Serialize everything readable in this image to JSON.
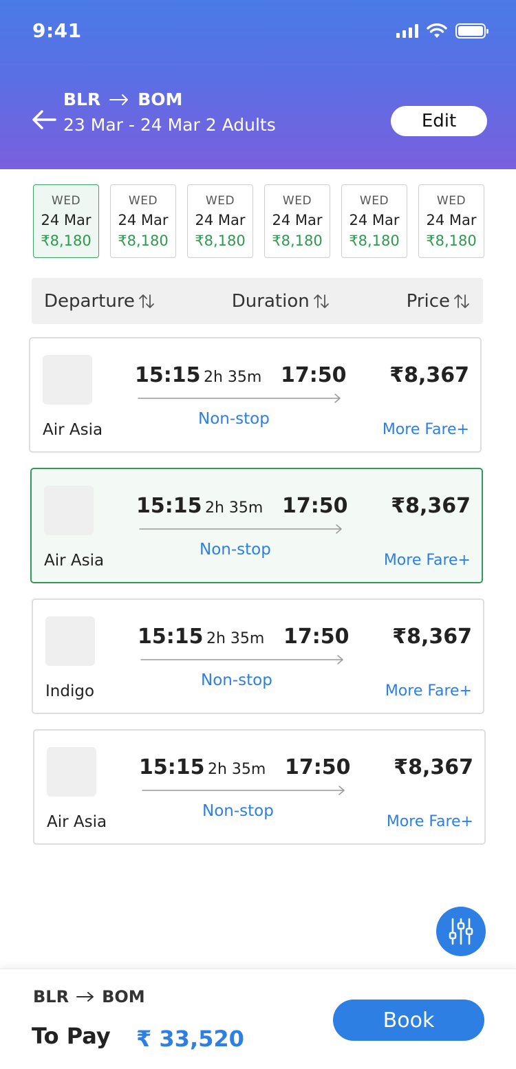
{
  "status_bar": {
    "time": "9:41"
  },
  "header": {
    "origin": "BLR",
    "destination": "BOM",
    "trip_info": "23 Mar - 24 Mar 2 Adults",
    "edit_label": "Edit"
  },
  "dates": [
    {
      "day": "WED",
      "date": "24 Mar",
      "price": "₹8,180",
      "selected": true
    },
    {
      "day": "WED",
      "date": "24 Mar",
      "price": "₹8,180",
      "selected": false
    },
    {
      "day": "WED",
      "date": "24 Mar",
      "price": "₹8,180",
      "selected": false
    },
    {
      "day": "WED",
      "date": "24 Mar",
      "price": "₹8,180",
      "selected": false
    },
    {
      "day": "WED",
      "date": "24 Mar",
      "price": "₹8,180",
      "selected": false
    },
    {
      "day": "WED",
      "date": "24 Mar",
      "price": "₹8,180",
      "selected": false
    }
  ],
  "sort": {
    "departure": "Departure",
    "duration": "Duration",
    "price": "Price"
  },
  "flights": [
    {
      "airline": "Air Asia",
      "departure": "15:15",
      "duration": "2h 35m",
      "arrival": "17:50",
      "stops": "Non-stop",
      "price": "₹8,367",
      "more_fare": "More Fare+",
      "selected": false
    },
    {
      "airline": "Air Asia",
      "departure": "15:15",
      "duration": "2h 35m",
      "arrival": "17:50",
      "stops": "Non-stop",
      "price": "₹8,367",
      "more_fare": "More Fare+",
      "selected": true
    },
    {
      "airline": "Indigo",
      "departure": "15:15",
      "duration": "2h 35m",
      "arrival": "17:50",
      "stops": "Non-stop",
      "price": "₹8,367",
      "more_fare": "More Fare+",
      "selected": false
    },
    {
      "airline": "Air Asia",
      "departure": "15:15",
      "duration": "2h 35m",
      "arrival": "17:50",
      "stops": "Non-stop",
      "price": "₹8,367",
      "more_fare": "More Fare+",
      "selected": false
    }
  ],
  "bottom": {
    "origin": "BLR",
    "destination": "BOM",
    "to_pay_label": "To Pay",
    "to_pay_amount": "₹ 33,520",
    "book_label": "Book"
  },
  "icons": {
    "back": "arrow-left-icon",
    "route": "arrow-right-icon",
    "sort": "sort-up-down-icon",
    "filter": "sliders-icon",
    "signal": "signal-icon",
    "wifi": "wifi-icon",
    "battery": "battery-icon"
  },
  "colors": {
    "accent": "#2d7fe3",
    "header_gradient_top": "#4a7be6",
    "header_gradient_bottom": "#7a5fde",
    "selected_border": "#2f9a55",
    "price_green": "#2d9a4e"
  }
}
